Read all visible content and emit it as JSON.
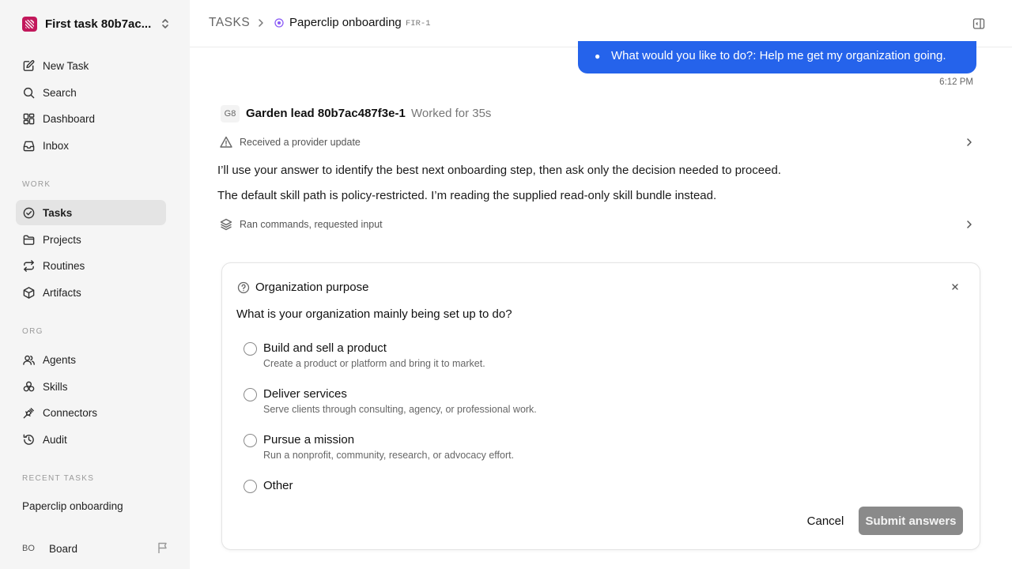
{
  "sidebar": {
    "org_name": "First task 80b7ac...",
    "nav_main": [
      {
        "label": "New Task",
        "icon": "edit-icon"
      },
      {
        "label": "Search",
        "icon": "search-icon"
      },
      {
        "label": "Dashboard",
        "icon": "dashboard-icon"
      },
      {
        "label": "Inbox",
        "icon": "inbox-icon"
      }
    ],
    "work_label": "WORK",
    "nav_work": [
      {
        "label": "Tasks",
        "icon": "check-circle-icon",
        "active": true
      },
      {
        "label": "Projects",
        "icon": "folder-icon"
      },
      {
        "label": "Routines",
        "icon": "repeat-icon"
      },
      {
        "label": "Artifacts",
        "icon": "box-icon"
      }
    ],
    "org_label": "ORG",
    "nav_org": [
      {
        "label": "Agents",
        "icon": "users-icon"
      },
      {
        "label": "Skills",
        "icon": "skills-icon"
      },
      {
        "label": "Connectors",
        "icon": "plug-icon"
      },
      {
        "label": "Audit",
        "icon": "history-icon"
      }
    ],
    "recent_label": "RECENT TASKS",
    "recent_tasks": [
      "Paperclip onboarding"
    ],
    "board": {
      "initials": "BO",
      "name": "Board"
    }
  },
  "header": {
    "section": "TASKS",
    "task_title": "Paperclip onboarding",
    "task_id": "FIR-1"
  },
  "chat": {
    "user_message": "What would you like to do?: Help me get my organization going.",
    "user_time": "6:12 PM",
    "agent": {
      "initials": "G8",
      "name": "Garden lead 80b7ac487f3e-1",
      "worked": "Worked for 35s"
    },
    "event_provider": "Received a provider update",
    "paragraph_1": "I’ll use your answer to identify the best next onboarding step, then ask only the decision needed to proceed.",
    "paragraph_2": "The default skill path is policy-restricted. I’m reading the supplied read-only skill bundle instead.",
    "event_commands": "Ran commands, requested input"
  },
  "question_card": {
    "title": "Organization purpose",
    "question": "What is your organization mainly being set up to do?",
    "options": [
      {
        "label": "Build and sell a product",
        "description": "Create a product or platform and bring it to market."
      },
      {
        "label": "Deliver services",
        "description": "Serve clients through consulting, agency, or professional work."
      },
      {
        "label": "Pursue a mission",
        "description": "Run a nonprofit, community, research, or advocacy effort."
      },
      {
        "label": "Other",
        "description": ""
      }
    ],
    "cancel_label": "Cancel",
    "submit_label": "Submit answers"
  },
  "colors": {
    "accent": "#2563eb",
    "sidebar_bg": "#f5f5f5",
    "active_nav_bg": "#e4e4e4",
    "status_purple": "#8b5cf6",
    "submit_disabled": "#8a8a8a"
  }
}
